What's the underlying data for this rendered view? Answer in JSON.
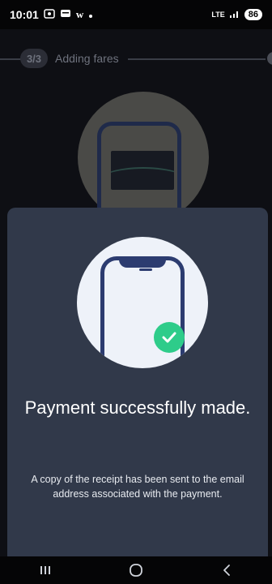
{
  "status_bar": {
    "time": "10:01",
    "left_icons": [
      "screen-record-icon",
      "message-icon",
      "w-icon",
      "dot-icon"
    ],
    "w_glyph": "w",
    "network": "LTE",
    "battery": "86"
  },
  "background": {
    "step": "3/3",
    "step_label": "Adding fares"
  },
  "modal": {
    "title": "Payment successfully made.",
    "message": "A copy of the receipt has been sent to the email address associated with the payment.",
    "accent": "#2ecc8a"
  },
  "nav_bar": {
    "icons": [
      "recent-apps-icon",
      "home-icon",
      "back-icon"
    ]
  }
}
